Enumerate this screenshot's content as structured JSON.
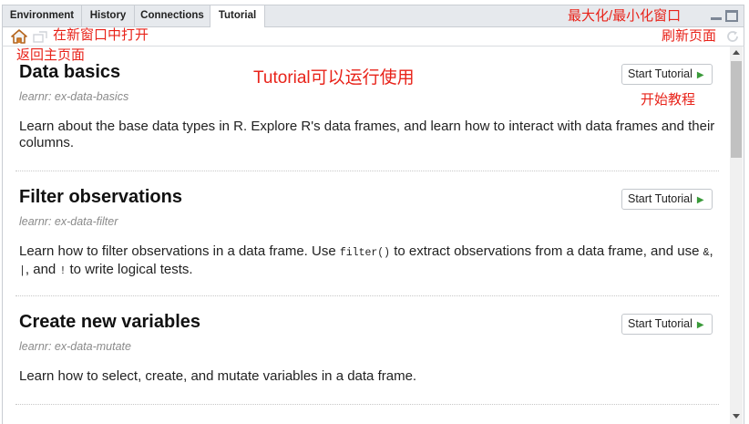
{
  "tabs": [
    {
      "label": "Environment"
    },
    {
      "label": "History"
    },
    {
      "label": "Connections"
    },
    {
      "label": "Tutorial"
    }
  ],
  "active_tab": "Tutorial",
  "tutorials": [
    {
      "title": "Data basics",
      "subtitle": "learnr: ex-data-basics",
      "description": "Learn about the base data types in R. Explore R's data frames, and learn how to interact with data frames and their columns.",
      "button": "Start Tutorial"
    },
    {
      "title": "Filter observations",
      "subtitle": "learnr: ex-data-filter",
      "desc_part1": "Learn how to filter observations in a data frame. Use ",
      "desc_code1": "filter()",
      "desc_part2": " to extract observations from a data frame, and use ",
      "desc_code2": "&",
      "desc_part3": ", ",
      "desc_code3": "|",
      "desc_part4": ", and ",
      "desc_code4": "!",
      "desc_part5": " to write logical tests.",
      "button": "Start Tutorial"
    },
    {
      "title": "Create new variables",
      "subtitle": "learnr: ex-data-mutate",
      "description": "Learn how to select, create, and mutate variables in a data frame.",
      "button": "Start Tutorial"
    }
  ],
  "annotations": {
    "maximize": "最大化/最小化窗口",
    "new_window": "在新窗口中打开",
    "home": "返回主页面",
    "refresh": "刷新页面",
    "runnable": "Tutorial可以运行使用",
    "start": "开始教程"
  },
  "icons": {
    "home": "home-icon",
    "popout": "popout-icon",
    "refresh": "refresh-icon",
    "minimize": "minimize-icon",
    "maximize": "maximize-icon",
    "play": "play-icon"
  },
  "colors": {
    "annotation": "#e8231a",
    "play": "#3a9a3a",
    "tabbar": "#e6e9ed"
  }
}
